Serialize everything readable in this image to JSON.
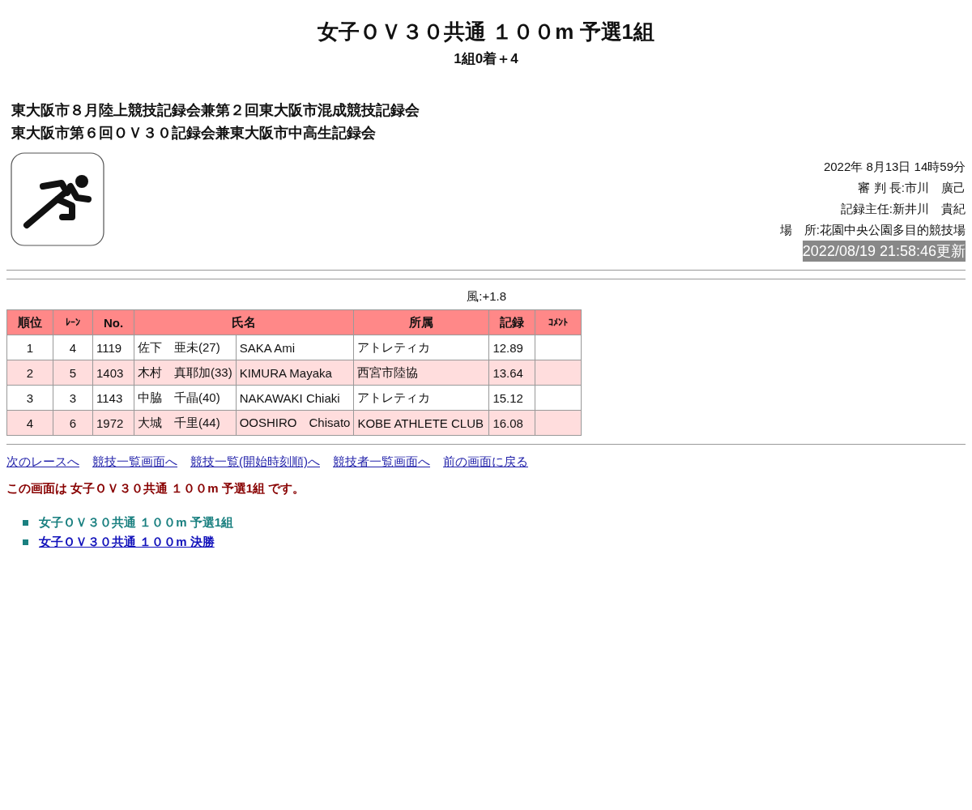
{
  "title": "女子ＯＶ３０共通 １００m 予選1組",
  "subtitle": "1組0着＋4",
  "meet_names": [
    "東大阪市８月陸上競技記録会兼第２回東大阪市混成競技記録会",
    "東大阪市第６回ＯＶ３０記録会兼東大阪市中高生記録会"
  ],
  "info": [
    "2022年 8月13日 14時59分",
    "審 判 長:市川　廣己",
    "記録主任:新井川　貴紀",
    "場　所:花園中央公園多目的競技場"
  ],
  "updated": "2022/08/19 21:58:46更新",
  "wind": "風:+1.8",
  "table": {
    "columns": [
      "順位",
      "ﾚｰﾝ",
      "No.",
      "氏名",
      "所属",
      "記録",
      "ｺﾒﾝﾄ"
    ],
    "rows": [
      {
        "rank": "1",
        "lane": "4",
        "no": "1119",
        "name": "佐下　亜未(27)",
        "name_roman": "SAKA Ami",
        "team": "アトレティカ",
        "record": "12.89"
      },
      {
        "rank": "2",
        "lane": "5",
        "no": "1403",
        "name": "木村　真耶加(33)",
        "name_roman": "KIMURA Mayaka",
        "team": "西宮市陸協",
        "record": "13.64"
      },
      {
        "rank": "3",
        "lane": "3",
        "no": "1143",
        "name": "中脇　千晶(40)",
        "name_roman": "NAKAWAKI Chiaki",
        "team": "アトレティカ",
        "record": "15.12"
      },
      {
        "rank": "4",
        "lane": "6",
        "no": "1972",
        "name": "大城　千里(44)",
        "name_roman": "OOSHIRO　Chisato",
        "team": "KOBE ATHLETE CLUB",
        "record": "16.08"
      }
    ]
  },
  "nav_links": [
    "次のレースへ",
    "競技一覧画面へ",
    "競技一覧(開始時刻順)へ",
    "競技者一覧画面へ",
    "前の画面に戻る"
  ],
  "current_note": "この画面は 女子ＯＶ３０共通 １００m 予選1組 です。",
  "races": [
    {
      "label": "女子ＯＶ３０共通 １００m 予選1組",
      "selected": true
    },
    {
      "label": "女子ＯＶ３０共通 １００m 決勝",
      "selected": false
    }
  ]
}
